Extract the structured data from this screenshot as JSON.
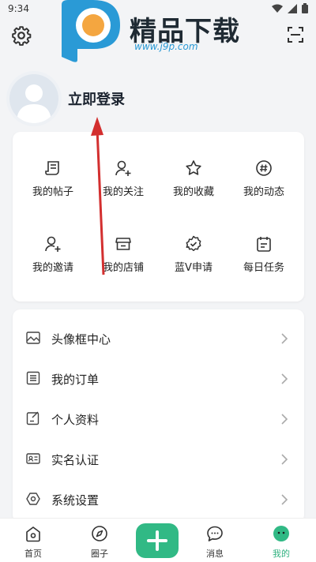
{
  "status_bar": {
    "time": "9:34"
  },
  "watermark": {
    "title": "精品下载",
    "url": "www.j9p.com"
  },
  "profile": {
    "login_label": "立即登录"
  },
  "grid": [
    {
      "label": "我的帖子",
      "icon": "posts-icon"
    },
    {
      "label": "我的关注",
      "icon": "follow-icon"
    },
    {
      "label": "我的收藏",
      "icon": "star-icon"
    },
    {
      "label": "我的动态",
      "icon": "hashtag-icon"
    },
    {
      "label": "我的邀请",
      "icon": "invite-icon"
    },
    {
      "label": "我的店铺",
      "icon": "store-icon"
    },
    {
      "label": "蓝V申请",
      "icon": "verified-badge-icon"
    },
    {
      "label": "每日任务",
      "icon": "calendar-icon"
    }
  ],
  "menu": [
    {
      "label": "头像框中心",
      "icon": "image-frame-icon"
    },
    {
      "label": "我的订单",
      "icon": "order-list-icon"
    },
    {
      "label": "个人资料",
      "icon": "edit-profile-icon"
    },
    {
      "label": "实名认证",
      "icon": "id-card-icon"
    },
    {
      "label": "系统设置",
      "icon": "settings-hexagon-icon"
    }
  ],
  "bottom_nav": {
    "home": "首页",
    "circle": "圈子",
    "messages": "消息",
    "me": "我的"
  },
  "colors": {
    "accent": "#31b985",
    "annotation_arrow": "#d32f2f"
  }
}
